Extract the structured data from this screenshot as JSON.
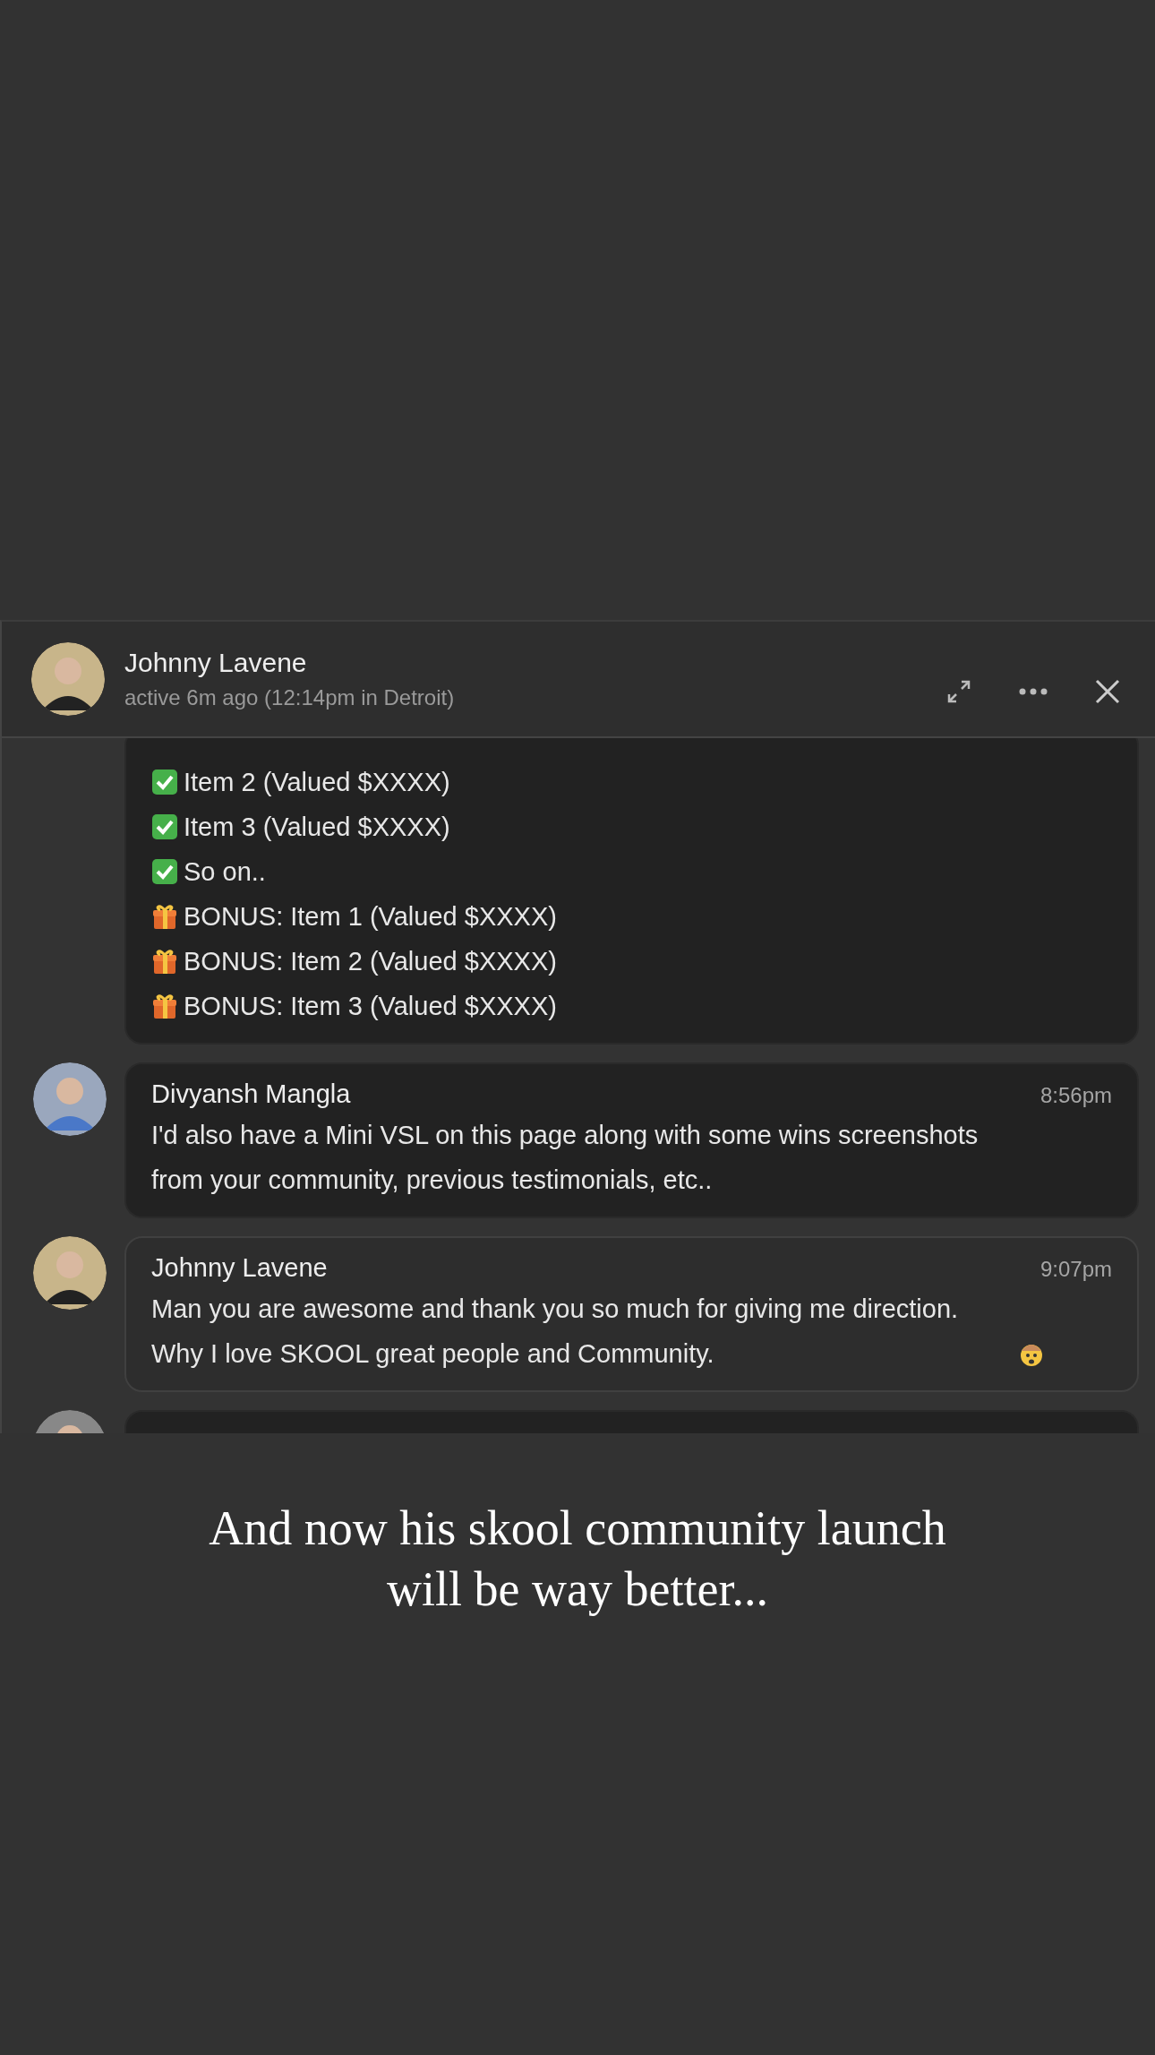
{
  "chat": {
    "header": {
      "name": "Johnny Lavene",
      "status": "active 6m ago (12:14pm in Detroit)"
    },
    "messages": [
      {
        "kind": "list",
        "lines": [
          {
            "kind": "check",
            "text": "Item 2 (Valued $XXXX)"
          },
          {
            "kind": "check",
            "text": "Item 3 (Valued $XXXX)"
          },
          {
            "kind": "check",
            "text": "So on.."
          },
          {
            "kind": "gift",
            "text": "BONUS: Item 1 (Valued $XXXX)"
          },
          {
            "kind": "gift",
            "text": "BONUS: Item 2 (Valued $XXXX)"
          },
          {
            "kind": "gift",
            "text": "BONUS: Item 3 (Valued $XXXX)"
          }
        ]
      },
      {
        "kind": "text",
        "author": "Divyansh Mangla",
        "time": "8:56pm",
        "text": "I'd also have a Mini VSL on this page along with some wins screenshots from your community, previous testimonials, etc.."
      },
      {
        "kind": "emoji-text",
        "author": "Johnny Lavene",
        "time": "9:07pm",
        "text": "Man you are awesome and thank you so much for giving me direction. Why I love SKOOL great people and Community."
      }
    ],
    "more_below": true
  },
  "caption_lines": [
    "And now his skool community launch",
    "will be way better..."
  ]
}
